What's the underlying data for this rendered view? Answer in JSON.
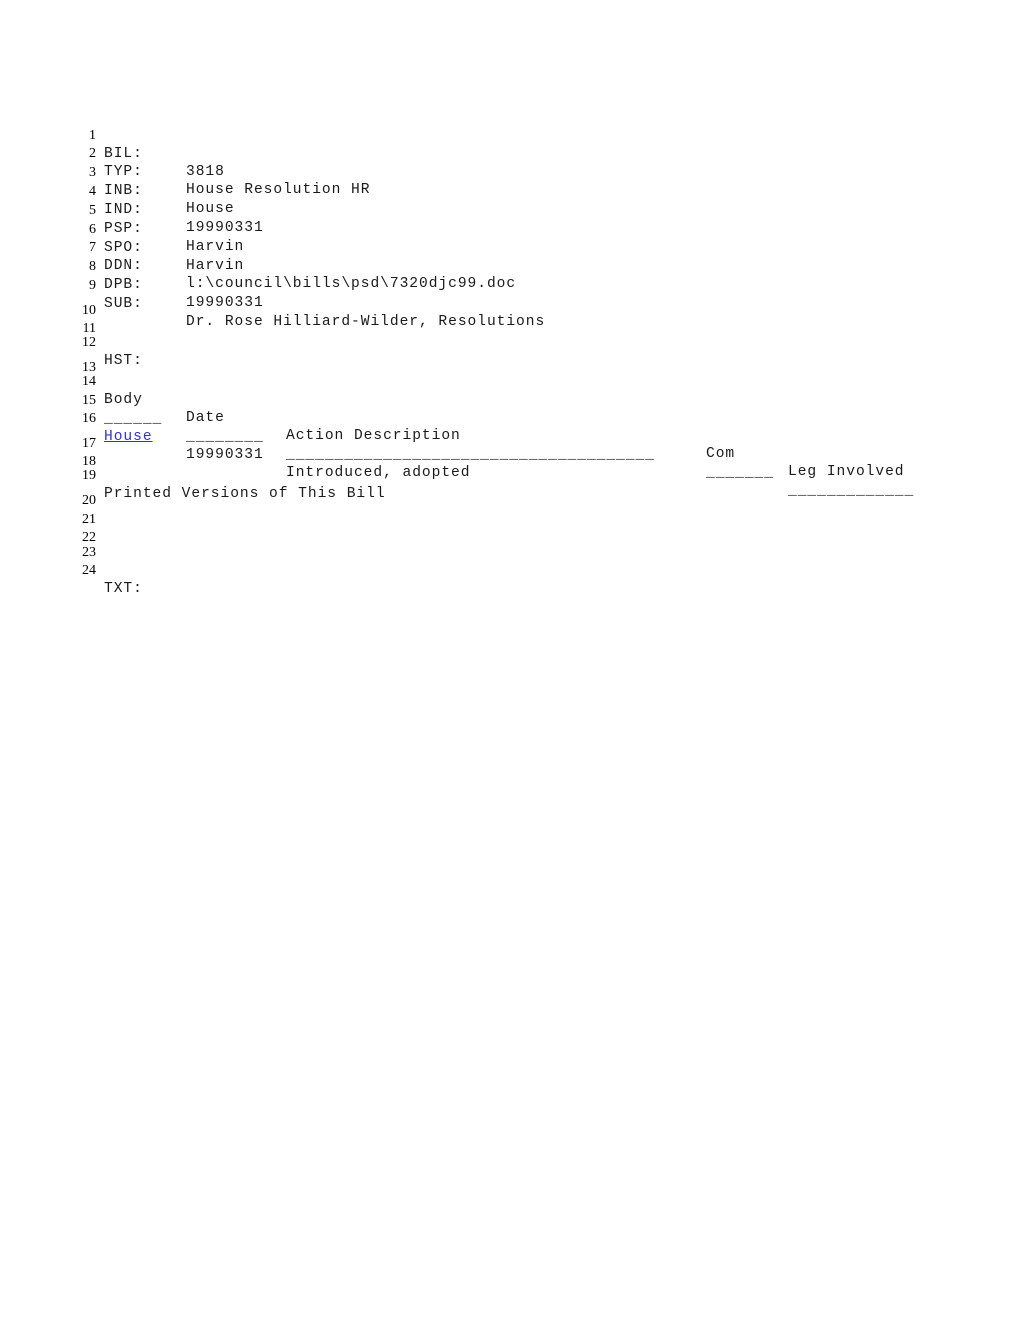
{
  "document": {
    "title": "Bill 3818 - House Resolution",
    "link_color": "#3333cc",
    "text_color": "#1a1a1a",
    "background_color": "#ffffff"
  },
  "fields": {
    "bil_label": "BIL:",
    "bil_value": "3818",
    "typ_label": "TYP:",
    "typ_value": "House Resolution HR",
    "inb_label": "INB:",
    "inb_value": "House",
    "ind_label": "IND:",
    "ind_value": "19990331",
    "psp_label": "PSP:",
    "psp_value": "Harvin",
    "spo_label": "SPO:",
    "spo_value": "Harvin",
    "ddn_label": "DDN:",
    "ddn_value": "l:\\council\\bills\\psd\\7320djc99.doc",
    "dpb_label": "DPB:",
    "dpb_value": "19990331",
    "sub_label": "SUB:",
    "sub_value": "Dr. Rose Hilliard-Wilder, Resolutions",
    "hst_label": "HST:",
    "txt_label": "TXT:"
  },
  "history_table": {
    "headers": {
      "body": "Body",
      "date": "Date",
      "action": "Action Description",
      "com": "Com",
      "leg": "Leg Involved"
    },
    "rules": {
      "body": "______",
      "date": "________",
      "action": "______________________________________",
      "com": "_______",
      "leg": "_____________"
    },
    "rows": [
      {
        "body": "House",
        "body_is_link": true,
        "date": "19990331",
        "action": "Introduced, adopted",
        "com": "",
        "leg": ""
      }
    ]
  },
  "printed_versions": {
    "heading": "Printed Versions of This Bill"
  },
  "line_numbers": {
    "n1": "1",
    "n2": "2",
    "n3": "3",
    "n4": "4",
    "n5": "5",
    "n6": "6",
    "n7": "7",
    "n8": "8",
    "n9": "9",
    "n10": "10",
    "n11": "11",
    "n12": "12",
    "n13": "13",
    "n14": "14",
    "n15": "15",
    "n16": "16",
    "n17": "17",
    "n18": "18",
    "n19": "19",
    "n20": "20",
    "n21": "21",
    "n22": "22",
    "n23": "23",
    "n24": "24"
  }
}
